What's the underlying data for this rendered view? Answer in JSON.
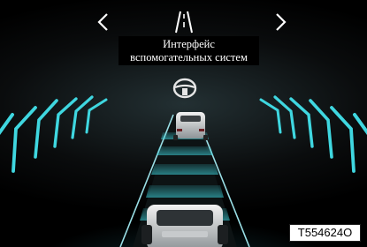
{
  "screen": {
    "title_line1": "Интерфейс",
    "title_line2": "вспомогательных систем",
    "image_code": "T554624O"
  },
  "nav": {
    "prev_icon": "chevron-left-icon",
    "next_icon": "chevron-right-icon",
    "lane_icon": "lane-view-icon"
  },
  "status": {
    "steering_icon": "steering-wheel-icon"
  },
  "colors": {
    "accent": "#3fd7e0",
    "background": "#0b0e0f",
    "text": "#ffffff"
  }
}
